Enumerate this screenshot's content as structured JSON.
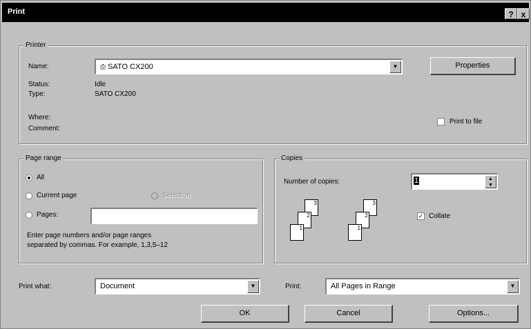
{
  "window": {
    "title": "Print",
    "help_label": "?",
    "close_label": "x"
  },
  "printer": {
    "group_label": "Printer",
    "name_label": "Name:",
    "name_value": "SATO CX200",
    "properties_label": "Properties",
    "status_label": "Status:",
    "status_value": "Idle",
    "type_label": "Type:",
    "type_value": "SATO CX200",
    "where_label": "Where:",
    "comment_label": "Comment:",
    "print_to_file_label": "Print to file"
  },
  "page_range": {
    "group_label": "Page range",
    "all_label": "All",
    "current_label": "Current page",
    "selection_label": "Selection",
    "pages_label": "Pages:",
    "pages_value": "",
    "help_text_1": "Enter page numbers and/or page ranges",
    "help_text_2": "separated by commas.  For example, 1,3,5–12"
  },
  "copies": {
    "group_label": "Copies",
    "number_label": "Number of copies:",
    "number_value": "1",
    "collate_label": "Collate",
    "collate_checked": true,
    "page_numbers": [
      "3",
      "2",
      "1",
      "3",
      "2",
      "1"
    ]
  },
  "bottom": {
    "print_what_label": "Print what:",
    "print_what_value": "Document",
    "print_label": "Print:",
    "print_value": "All Pages in Range"
  },
  "buttons": {
    "ok": "OK",
    "cancel": "Cancel",
    "options": "Options..."
  }
}
